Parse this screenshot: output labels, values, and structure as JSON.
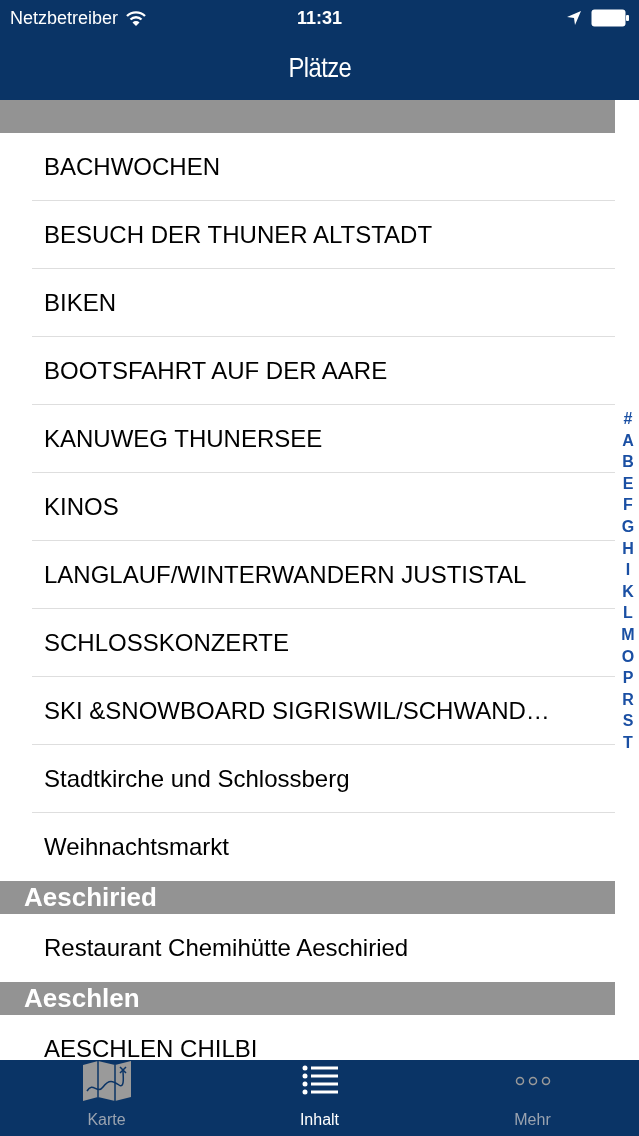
{
  "status_bar": {
    "carrier": "Netzbetreiber",
    "time": "11:31"
  },
  "nav": {
    "title": "Plätze"
  },
  "sections": [
    {
      "items": [
        "BACHWOCHEN",
        "BESUCH DER THUNER ALTSTADT",
        "BIKEN",
        "BOOTSFAHRT AUF DER AARE",
        "KANUWEG THUNERSEE",
        "KINOS",
        "LANGLAUF/WINTERWANDERN JUSTISTAL",
        "SCHLOSSKONZERTE",
        "SKI &SNOWBOARD SIGRISWIL/SCHWAND…",
        "Stadtkirche und Schlossberg",
        "Weihnachtsmarkt"
      ]
    },
    {
      "header": "Aeschiried",
      "items": [
        "Restaurant Chemihütte Aeschiried"
      ]
    },
    {
      "header": "Aeschlen",
      "items": [
        "AESCHLEN CHILBI"
      ]
    }
  ],
  "index": [
    "#",
    "A",
    "B",
    "E",
    "F",
    "G",
    "H",
    "I",
    "K",
    "L",
    "M",
    "O",
    "P",
    "R",
    "S",
    "T"
  ],
  "tabs": [
    {
      "label": "Karte",
      "kind": "map",
      "selected": false
    },
    {
      "label": "Inhalt",
      "kind": "list",
      "selected": true
    },
    {
      "label": "Mehr",
      "kind": "more",
      "selected": false
    }
  ]
}
